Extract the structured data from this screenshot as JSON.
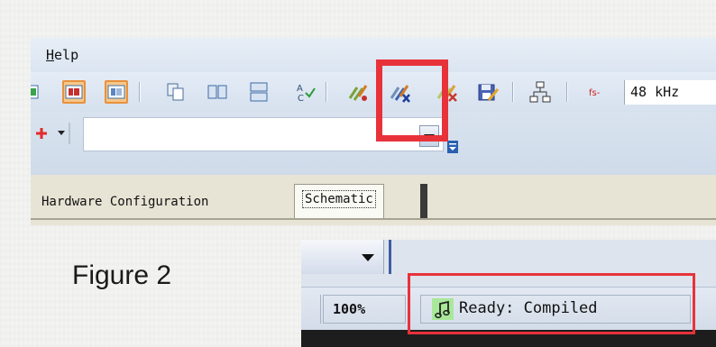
{
  "menu": {
    "help_first": "H",
    "help_rest": "elp"
  },
  "toolbar": {
    "buttons": [
      {
        "icon": "layout-green-icon"
      },
      {
        "icon": "layout-red-icon",
        "pressed": true
      },
      {
        "icon": "layout-blue-icon",
        "pressed": true
      },
      {
        "icon": "copy-icon"
      },
      {
        "icon": "tile-horizontal-icon"
      },
      {
        "icon": "tile-vertical-icon"
      },
      {
        "icon": "spell-check-icon"
      },
      {
        "icon": "link-compile-icon"
      },
      {
        "icon": "link-compile-download-icon"
      },
      {
        "icon": "stop-icon"
      },
      {
        "icon": "save-edit-icon"
      },
      {
        "icon": "hierarchy-icon"
      }
    ],
    "fs_label": "fs-",
    "fs_value": "48 kHz"
  },
  "tabs": [
    {
      "label": "Hardware Configuration"
    },
    {
      "label": "Schematic",
      "active": true
    }
  ],
  "caption": "Figure 2",
  "statusbar": {
    "zoom": "100%",
    "status": "Ready: Compiled"
  },
  "colors": {
    "highlight": "#e8323a",
    "pressed_bg": "#f7c789",
    "pressed_border": "#e8913c",
    "status_icon_bg": "#a9e89a"
  }
}
